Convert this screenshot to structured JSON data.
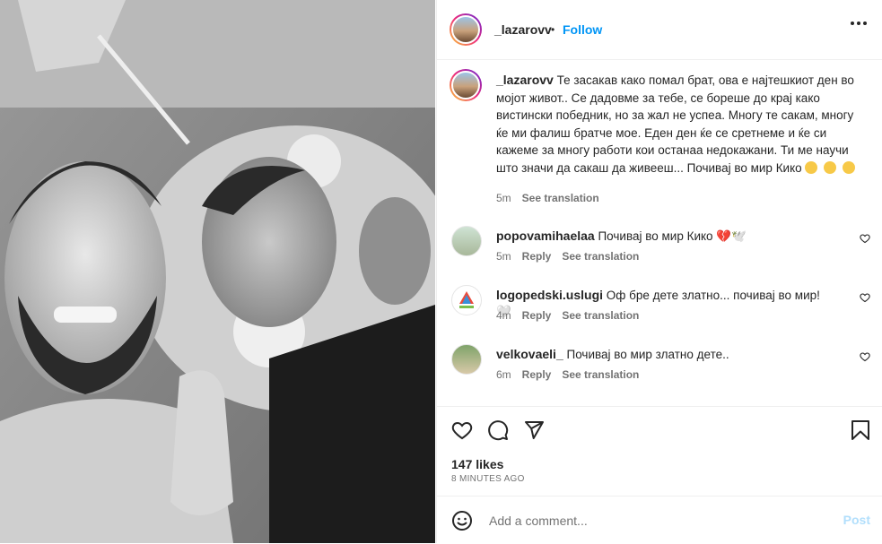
{
  "post": {
    "author": "_lazarovv",
    "follow_label": "Follow",
    "dot": "•",
    "caption": "Те засакав како помал брат, ова е најтешкиот ден во мојот живот.. Се дадовме за тебе, се бореше до крај како вистински победник, но за жал не успеа. Многу те сакам, многу ќе ми фалиш братче мое. Еден ден ќе се сретнеме и ќе си кажеме за многу работи кои останаа недокажани. Ти ме научи што значи да сакаш да живееш... Почивај во мир Кико",
    "caption_time": "5m",
    "see_translation": "See translation"
  },
  "comments": [
    {
      "user": "popovamihaelaa",
      "text": "Почивај во мир Кико 💔🕊️",
      "time": "5m",
      "reply": "Reply",
      "see_translation": "See translation"
    },
    {
      "user": "logopedski.uslugi",
      "text": "Оф бре дете златно... почивај во мир! 🤍",
      "time": "4m",
      "reply": "Reply",
      "see_translation": "See translation"
    },
    {
      "user": "velkovaeli_",
      "text": "Почивај во мир златно дете..",
      "time": "6m",
      "reply": "Reply",
      "see_translation": "See translation"
    }
  ],
  "stats": {
    "likes": "147 likes",
    "time_ago": "8 MINUTES AGO"
  },
  "add_comment": {
    "placeholder": "Add a comment...",
    "post_label": "Post"
  },
  "icons": {
    "like": "heart-icon",
    "comment": "comment-icon",
    "share": "share-icon",
    "save": "bookmark-icon",
    "emoji": "emoji-icon",
    "more": "more-icon"
  },
  "colors": {
    "accent": "#0095f6",
    "post_disabled": "#b2dffc",
    "muted": "#737373",
    "text": "#262626"
  }
}
